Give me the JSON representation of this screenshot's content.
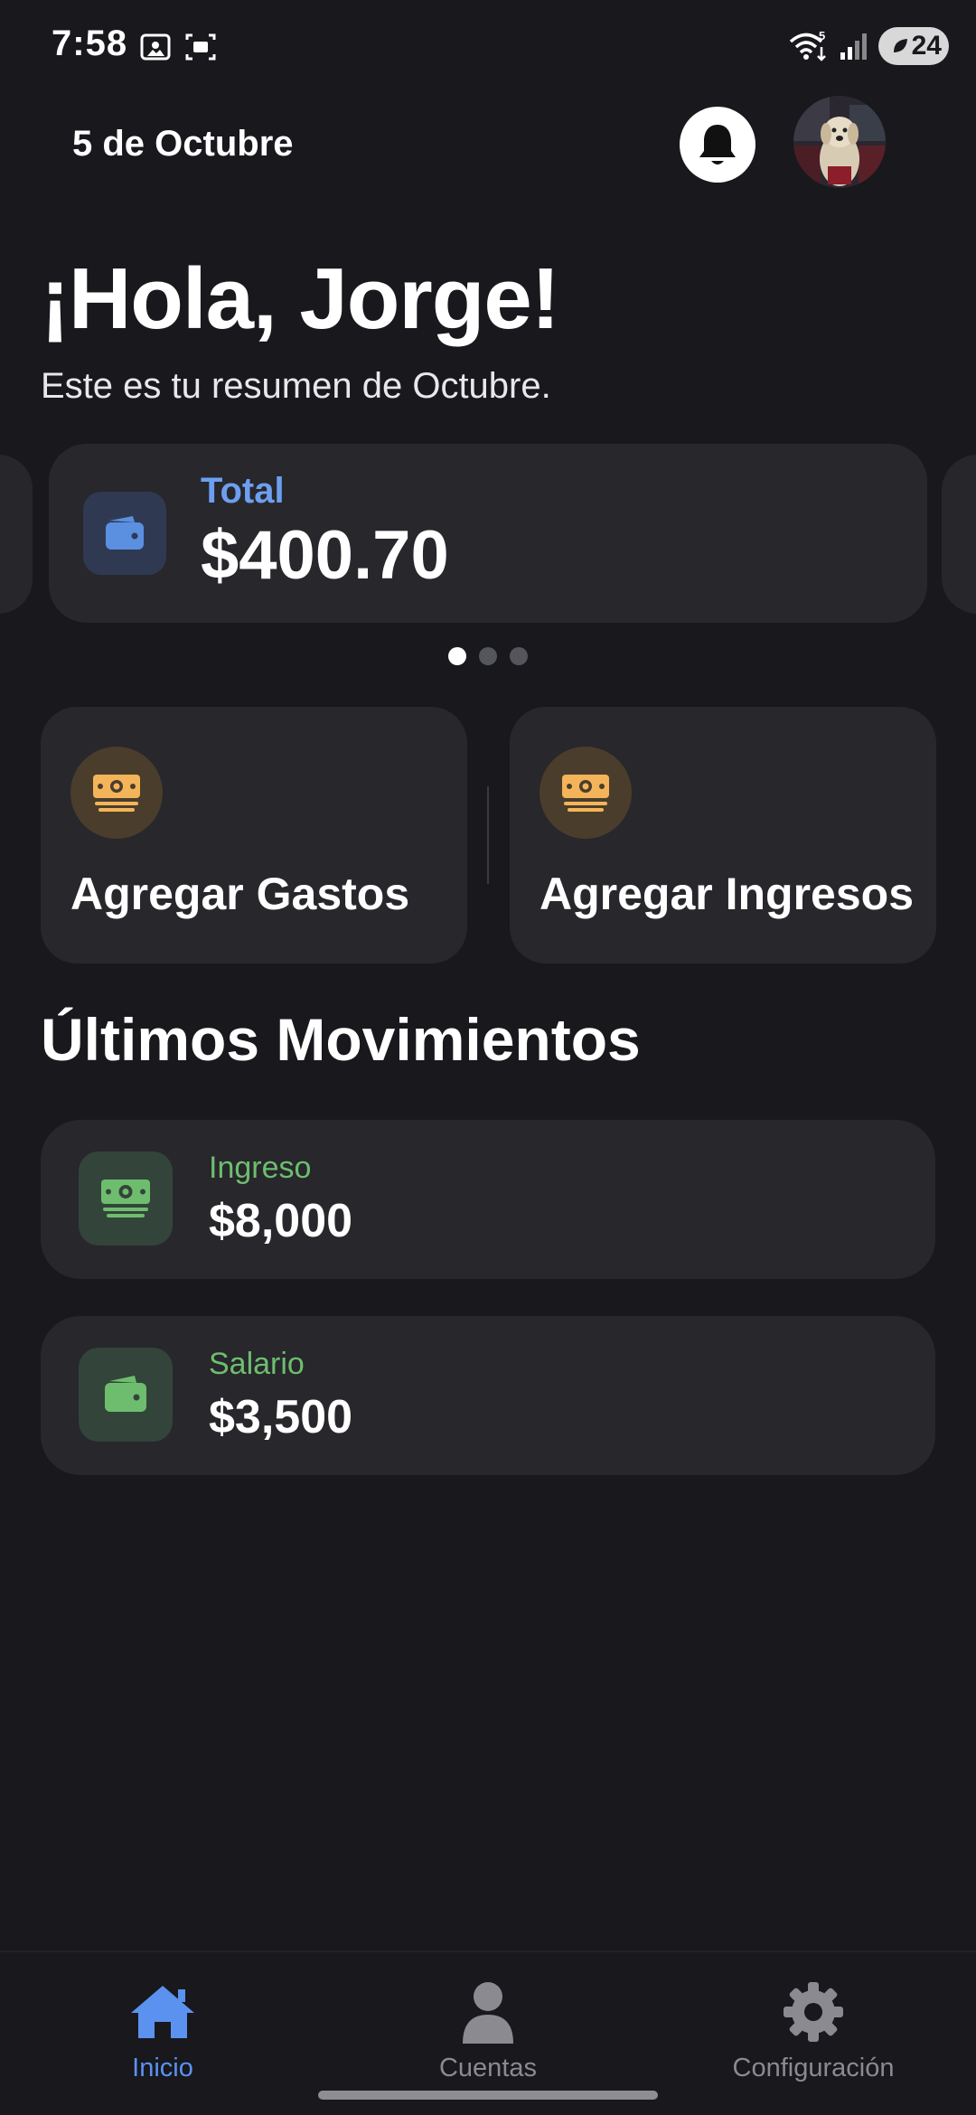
{
  "status_bar": {
    "time": "7:58",
    "battery": "24",
    "network_badge": "5"
  },
  "header": {
    "date": "5 de Octubre"
  },
  "greeting": {
    "title": "¡Hola, Jorge!",
    "subtitle": "Este es tu resumen de Octubre."
  },
  "balance_carousel": {
    "active_index": 0,
    "page_count": 3,
    "cards": [
      {
        "label": "Total",
        "amount": "$400.70",
        "icon": "wallet-icon"
      }
    ]
  },
  "actions": {
    "add_expense_label": "Agregar Gastos",
    "add_income_label": "Agregar Ingresos",
    "icon": "money-icon"
  },
  "recent": {
    "title": "Últimos Movimientos",
    "items": [
      {
        "label": "Ingreso",
        "amount": "$8,000",
        "icon": "money-icon"
      },
      {
        "label": "Salario",
        "amount": "$3,500",
        "icon": "wallet-icon"
      }
    ]
  },
  "bottom_nav": {
    "items": [
      {
        "label": "Inicio",
        "icon": "home-icon",
        "active": true
      },
      {
        "label": "Cuentas",
        "icon": "person-icon",
        "active": false
      },
      {
        "label": "Configuración",
        "icon": "gear-icon",
        "active": false
      }
    ]
  },
  "colors": {
    "background": "#18181d",
    "card": "#27272c",
    "accent_blue": "#5b92ef",
    "income_green": "#6ebd6e",
    "action_orange": "#f4b45a"
  }
}
